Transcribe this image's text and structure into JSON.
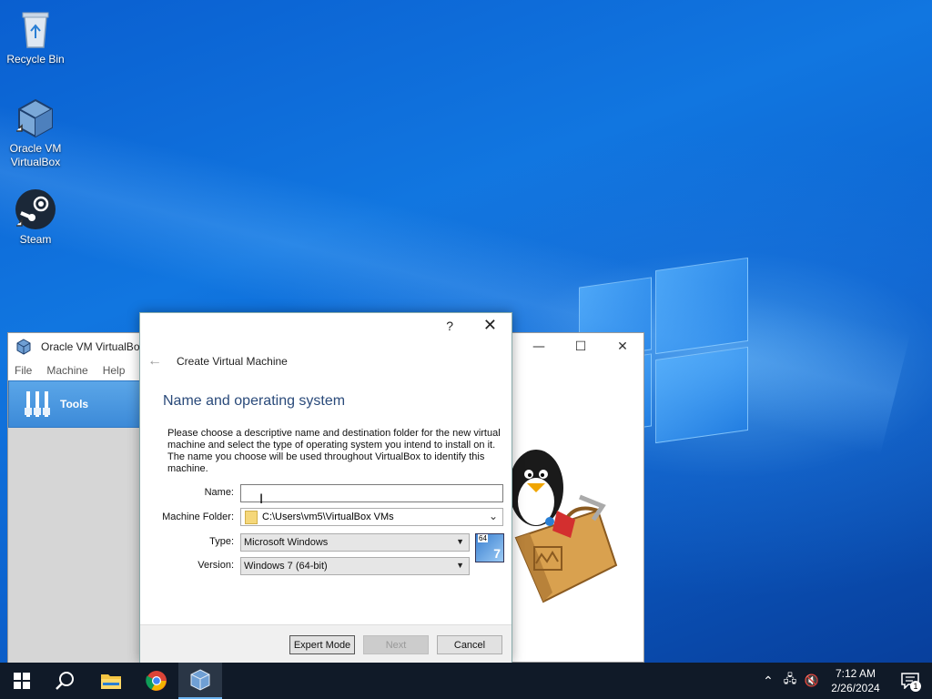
{
  "desktop": {
    "icons": [
      {
        "label": "Recycle Bin"
      },
      {
        "label": "Oracle VM VirtualBox"
      },
      {
        "label": "Steam"
      }
    ]
  },
  "vbox_window": {
    "title": "Oracle VM VirtualBox",
    "menu": [
      "File",
      "Machine",
      "Help"
    ],
    "tools_label": "Tools"
  },
  "dialog": {
    "help_glyph": "?",
    "close_glyph": "✕",
    "header": "Create Virtual Machine",
    "section_title": "Name and operating system",
    "description": "Please choose a descriptive name and destination folder for the new virtual machine and select the type of operating system you intend to install on it. The name you choose will be used throughout VirtualBox to identify this machine.",
    "form": {
      "name_label": "Name:",
      "name_value": "",
      "folder_label": "Machine Folder:",
      "folder_value": "C:\\Users\\vm5\\VirtualBox VMs",
      "type_label": "Type:",
      "type_value": "Microsoft Windows",
      "version_label": "Version:",
      "version_value": "Windows 7 (64-bit)",
      "os_badge": "64"
    },
    "buttons": {
      "expert": "Expert Mode",
      "next": "Next",
      "cancel": "Cancel"
    }
  },
  "taskbar": {
    "time": "7:12 AM",
    "date": "2/26/2024",
    "notification_count": "1"
  },
  "colors": {
    "accent": "#0a63cf",
    "section_title": "#2a4a7a",
    "taskbar": "#101a28"
  }
}
